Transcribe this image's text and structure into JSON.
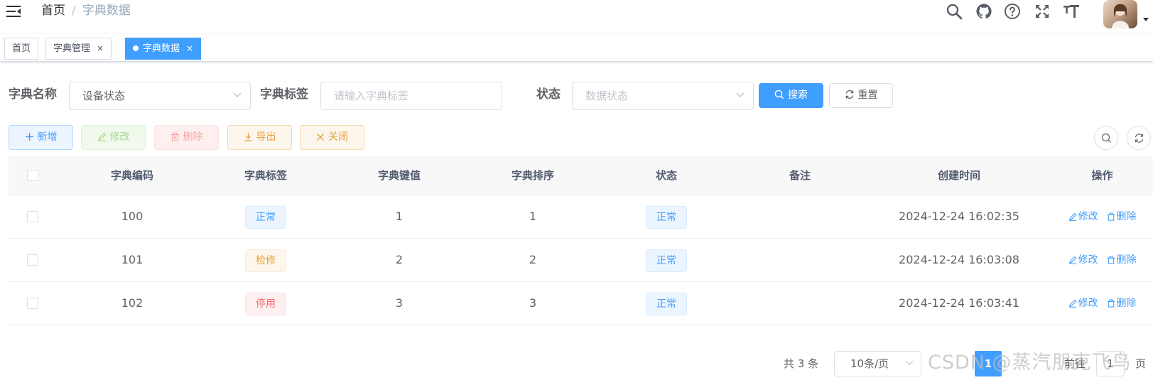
{
  "breadcrumb": {
    "home": "首页",
    "separator": "/",
    "current": "字典数据"
  },
  "navbar_icons": [
    "menu-fold-icon",
    "search-icon",
    "github-icon",
    "question-icon",
    "fullscreen-icon",
    "font-size-icon"
  ],
  "tags": [
    {
      "label": "首页",
      "active": false,
      "closable": false
    },
    {
      "label": "字典管理",
      "active": false,
      "closable": true,
      "close": "×"
    },
    {
      "label": "字典数据",
      "active": true,
      "closable": true,
      "close": "×"
    }
  ],
  "search_form": {
    "dict_name_label": "字典名称",
    "dict_name_value": "设备状态",
    "dict_label_label": "字典标签",
    "dict_label_placeholder": "请输入字典标签",
    "status_label": "状态",
    "status_placeholder": "数据状态",
    "search_btn": "搜索",
    "reset_btn": "重置"
  },
  "toolbar": {
    "add": "新增",
    "edit": "修改",
    "delete": "删除",
    "export": "导出",
    "close": "关闭"
  },
  "table": {
    "headers": [
      "字典编码",
      "字典标签",
      "字典键值",
      "字典排序",
      "状态",
      "备注",
      "创建时间",
      "操作"
    ],
    "rows": [
      {
        "code": "100",
        "label": "正常",
        "label_type": "primary",
        "value": "1",
        "sort": "1",
        "status": "正常",
        "remark": "",
        "created": "2024-12-24 16:02:35"
      },
      {
        "code": "101",
        "label": "检修",
        "label_type": "warning",
        "value": "2",
        "sort": "2",
        "status": "正常",
        "remark": "",
        "created": "2024-12-24 16:03:08"
      },
      {
        "code": "102",
        "label": "停用",
        "label_type": "danger",
        "value": "3",
        "sort": "3",
        "status": "正常",
        "remark": "",
        "created": "2024-12-24 16:03:41"
      }
    ],
    "op_edit": "修改",
    "op_delete": "删除"
  },
  "pagination": {
    "total": "共 3 条",
    "page_size": "10条/页",
    "current_page": "1",
    "goto_label": "前往",
    "goto_value": "1",
    "page_suffix": "页"
  },
  "watermark": "CSDN @蒸汽朋克飞鸟",
  "colors": {
    "primary": "#409eff",
    "success": "#67c23a",
    "warning": "#e6a23c",
    "danger": "#f56c6c"
  }
}
